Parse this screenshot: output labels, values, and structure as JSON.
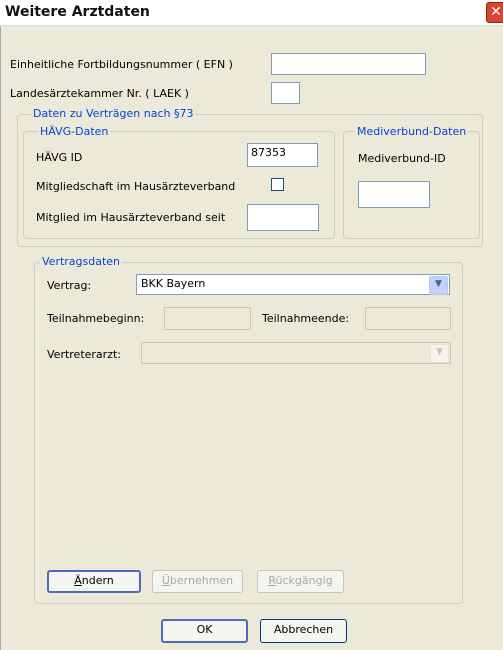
{
  "window": {
    "title": "Weitere Arztdaten",
    "close_glyph": "✕"
  },
  "efn": {
    "label": "Einheitliche Fortbildungsnummer ( EFN )",
    "value": ""
  },
  "laek": {
    "label": "Landesärztekammer Nr. ( LAEK )",
    "value": ""
  },
  "contracts": {
    "legend": "Daten zu Verträgen nach §73",
    "haevg": {
      "legend": "HÄVG-Daten",
      "id_label": "HÄVG ID",
      "id_value": "87353",
      "membership_label": "Mitgliedschaft im Hausärzteverband",
      "membership_checked": false,
      "member_since_label": "Mitglied im Hausärzteverband seit",
      "member_since_value": ""
    },
    "medi": {
      "legend": "Mediverbund-Daten",
      "id_label": "Mediverbund-ID",
      "id_value": ""
    }
  },
  "vertragsdaten": {
    "legend": "Vertragsdaten",
    "vertrag_label": "Vertrag:",
    "vertrag_value": "BKK Bayern",
    "begin_label": "Teilnahmebeginn:",
    "begin_value": "",
    "end_label": "Teilnahmeende:",
    "end_value": "",
    "vertreter_label": "Vertreterarzt:",
    "vertreter_value": ""
  },
  "actions": {
    "change": {
      "first": "Ä",
      "rest": "ndern"
    },
    "apply": {
      "first": "Ü",
      "rest": "bernehmen"
    },
    "undo": {
      "first": "R",
      "rest": "ückgängig"
    }
  },
  "footer": {
    "ok": "OK",
    "cancel": "Abbrechen"
  },
  "icons": {
    "dropdown": "chevron-down-icon",
    "close": "close-icon"
  }
}
